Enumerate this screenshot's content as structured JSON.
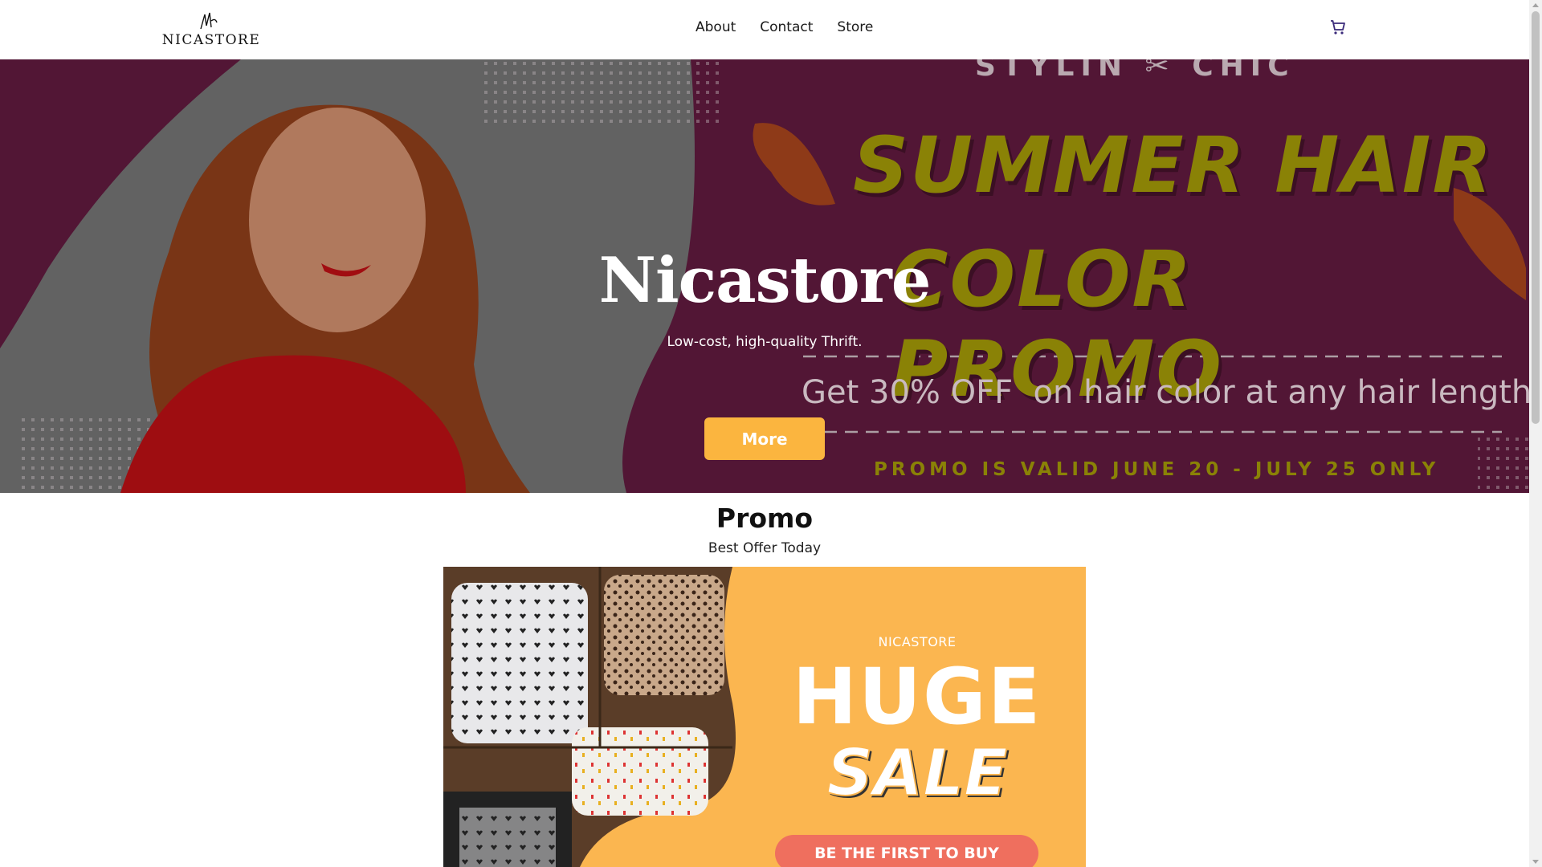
{
  "nav": {
    "logo_text": "NICASTORE",
    "links": [
      "About",
      "Contact",
      "Store"
    ],
    "cart_icon": "shopping-cart-icon"
  },
  "hero": {
    "title": "Nicastore",
    "subtitle": "Low-cost, high-quality Thrift.",
    "button_label": "More",
    "promo_brand": "STYLIN ✂ CHIC",
    "promo_line1": "SUMMER HAIR",
    "promo_line2": "COLOR PROMO",
    "promo_offer": "Get 30% OFF  on hair color at any hair length!",
    "promo_valid": "PROMO IS VALID JUNE 20 - JULY 25 ONLY"
  },
  "promo": {
    "title": "Promo",
    "subtitle": "Best Offer Today",
    "banner_brand": "NICASTORE",
    "banner_huge": "HUGE",
    "banner_sale": "SALE",
    "banner_cta": "BE THE FIRST TO BUY"
  },
  "colors": {
    "accent": "#fbb53f",
    "hero_bg": "#5c1a3a",
    "promo_yellow": "#8a8206",
    "cta": "#ef6f5e"
  }
}
